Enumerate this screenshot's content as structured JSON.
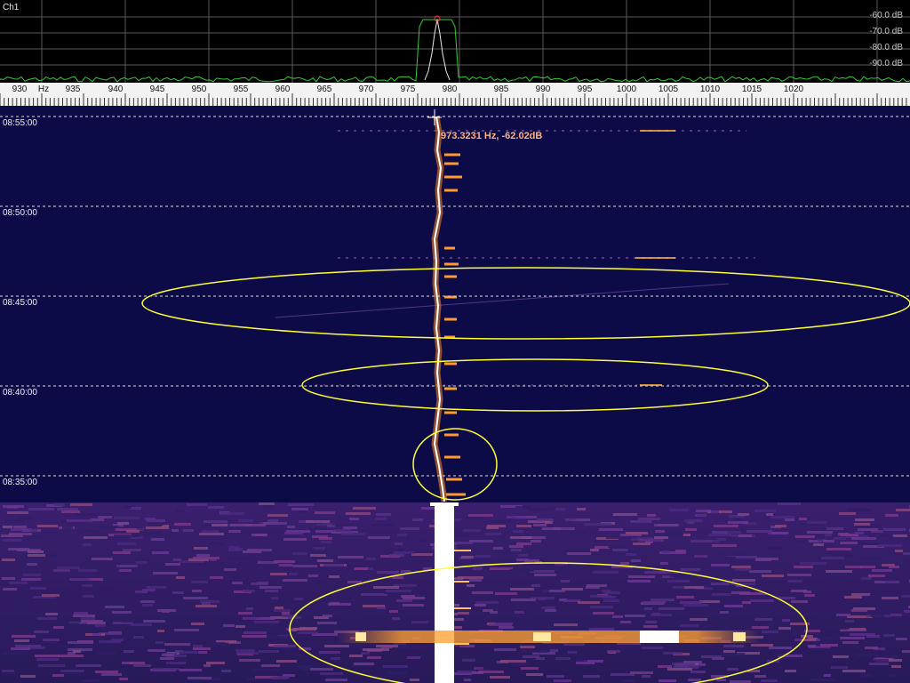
{
  "spectrum": {
    "channel": "Ch1",
    "db_labels": [
      "-60.0 dB",
      "-70.0 dB",
      "-80.0 dB",
      "-90.0 dB"
    ],
    "trace_color": "#33cc33",
    "peak_marker_color": "#ff3333"
  },
  "ruler": {
    "unit": "Hz",
    "ticks": [
      "930",
      "935",
      "940",
      "945",
      "950",
      "955",
      "960",
      "965",
      "970",
      "975",
      "980",
      "985",
      "990",
      "995",
      "1000",
      "1005",
      "1010",
      "1015",
      "1020"
    ]
  },
  "waterfall": {
    "times": [
      "08:55:00",
      "08:50:00",
      "08:45:00",
      "08:40:00",
      "08:35:00"
    ],
    "cursor_readout": "973.3231 Hz, -62.02dB",
    "background_color": "#0d0b47",
    "highlight_color": "#ffff33"
  }
}
